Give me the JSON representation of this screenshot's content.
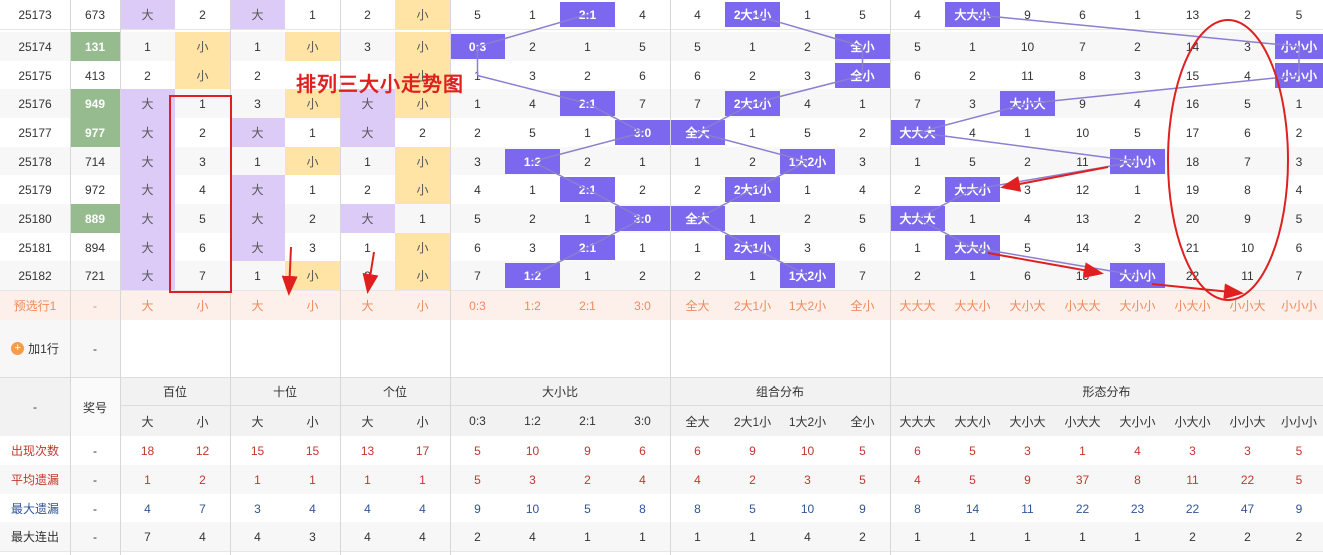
{
  "annotation": "排列三大小走势图",
  "columns": {
    "group_headers": [
      "百位",
      "十位",
      "个位",
      "大小比",
      "组合分布",
      "形态分布"
    ],
    "issue_header": "-",
    "prize_header": "奖号",
    "sub_headers": [
      "大",
      "小",
      "大",
      "小",
      "大",
      "小",
      "0:3",
      "1:2",
      "2:1",
      "3:0",
      "全大",
      "2大1小",
      "1大2小",
      "全小",
      "大大大",
      "大大小",
      "大小大",
      "小大大",
      "大小小",
      "小大小",
      "小小大",
      "小小小"
    ]
  },
  "rows": [
    {
      "issue": "25173",
      "prize": "673",
      "cells": [
        "大",
        "2",
        "大",
        "1",
        "2",
        "小",
        "5",
        "1",
        "2:1",
        "4",
        "4",
        "2大1小",
        "1",
        "5",
        "4",
        "大大小",
        "9",
        "6",
        "1",
        "13",
        "2",
        "5"
      ]
    },
    {
      "issue": "25174",
      "prize": "131",
      "cells": [
        "1",
        "小",
        "1",
        "小",
        "3",
        "小",
        "0:3",
        "2",
        "1",
        "5",
        "5",
        "1",
        "2",
        "全小",
        "5",
        "1",
        "10",
        "7",
        "2",
        "14",
        "3",
        "小小小"
      ]
    },
    {
      "issue": "25175",
      "prize": "413",
      "cells": [
        "2",
        "小",
        "2",
        "",
        "",
        "小",
        "1",
        "3",
        "2",
        "6",
        "6",
        "2",
        "3",
        "全小",
        "6",
        "2",
        "11",
        "8",
        "3",
        "15",
        "4",
        "小小小"
      ]
    },
    {
      "issue": "25176",
      "prize": "949",
      "cells": [
        "大",
        "1",
        "3",
        "小",
        "大",
        "小",
        "1",
        "4",
        "2:1",
        "7",
        "7",
        "2大1小",
        "4",
        "1",
        "7",
        "3",
        "大小大",
        "9",
        "4",
        "16",
        "5",
        "1"
      ]
    },
    {
      "issue": "25177",
      "prize": "977",
      "cells": [
        "大",
        "2",
        "大",
        "1",
        "大",
        "2",
        "2",
        "5",
        "1",
        "3:0",
        "全大",
        "1",
        "5",
        "2",
        "大大大",
        "4",
        "1",
        "10",
        "5",
        "17",
        "6",
        "2"
      ]
    },
    {
      "issue": "25178",
      "prize": "714",
      "cells": [
        "大",
        "3",
        "1",
        "小",
        "1",
        "小",
        "3",
        "1:2",
        "2",
        "1",
        "1",
        "2",
        "1大2小",
        "3",
        "1",
        "5",
        "2",
        "11",
        "大小小",
        "18",
        "7",
        "3"
      ]
    },
    {
      "issue": "25179",
      "prize": "972",
      "cells": [
        "大",
        "4",
        "大",
        "1",
        "2",
        "小",
        "4",
        "1",
        "2:1",
        "2",
        "2",
        "2大1小",
        "1",
        "4",
        "2",
        "大大小",
        "3",
        "12",
        "1",
        "19",
        "8",
        "4"
      ]
    },
    {
      "issue": "25180",
      "prize": "889",
      "cells": [
        "大",
        "5",
        "大",
        "2",
        "大",
        "1",
        "5",
        "2",
        "1",
        "3:0",
        "全大",
        "1",
        "2",
        "5",
        "大大大",
        "1",
        "4",
        "13",
        "2",
        "20",
        "9",
        "5"
      ]
    },
    {
      "issue": "25181",
      "prize": "894",
      "cells": [
        "大",
        "6",
        "大",
        "3",
        "1",
        "小",
        "6",
        "3",
        "2:1",
        "1",
        "1",
        "2大1小",
        "3",
        "6",
        "1",
        "大大小",
        "5",
        "14",
        "3",
        "21",
        "10",
        "6"
      ]
    },
    {
      "issue": "25182",
      "prize": "721",
      "cells": [
        "大",
        "7",
        "1",
        "小",
        "2",
        "小",
        "7",
        "1:2",
        "1",
        "2",
        "2",
        "1",
        "1大2小",
        "7",
        "2",
        "1",
        "6",
        "15",
        "大小小",
        "22",
        "11",
        "7"
      ]
    }
  ],
  "pick_row": {
    "label": "预选行1",
    "prize": "-",
    "cells": [
      "大",
      "小",
      "大",
      "小",
      "大",
      "小",
      "0:3",
      "1:2",
      "2:1",
      "3:0",
      "全大",
      "2大1小",
      "1大2小",
      "全小",
      "大大大",
      "大大小",
      "大小大",
      "小大大",
      "大小小",
      "小大小",
      "小小大",
      "小小小"
    ]
  },
  "add_row": {
    "label": "加1行",
    "value": "-",
    "icon": "plus-circle-icon"
  },
  "stats": [
    {
      "label": "出现次数",
      "prize": "-",
      "style": "red",
      "cells": [
        "18",
        "12",
        "15",
        "15",
        "13",
        "17",
        "5",
        "10",
        "9",
        "6",
        "6",
        "9",
        "10",
        "5",
        "6",
        "5",
        "3",
        "1",
        "4",
        "3",
        "3",
        "5"
      ]
    },
    {
      "label": "平均遗漏",
      "prize": "-",
      "style": "red",
      "cells": [
        "1",
        "2",
        "1",
        "1",
        "1",
        "1",
        "5",
        "3",
        "2",
        "4",
        "4",
        "2",
        "3",
        "5",
        "4",
        "5",
        "9",
        "37",
        "8",
        "11",
        "22",
        "5"
      ]
    },
    {
      "label": "最大遗漏",
      "prize": "-",
      "style": "blue",
      "cells": [
        "4",
        "7",
        "3",
        "4",
        "4",
        "4",
        "9",
        "10",
        "5",
        "8",
        "8",
        "5",
        "10",
        "9",
        "8",
        "14",
        "11",
        "22",
        "23",
        "22",
        "47",
        "9"
      ]
    },
    {
      "label": "最大连出",
      "prize": "-",
      "style": "normal",
      "cells": [
        "7",
        "4",
        "4",
        "3",
        "4",
        "4",
        "2",
        "4",
        "1",
        "1",
        "1",
        "1",
        "4",
        "2",
        "1",
        "1",
        "1",
        "1",
        "1",
        "2",
        "2",
        "2"
      ]
    }
  ],
  "colors": {
    "purple": "#7b68ee",
    "lavender": "#dccbf6",
    "yellow": "#ffe4a6",
    "green": "#95bb8f",
    "annotation_red": "#e02020",
    "pick": "#f08a5d"
  }
}
